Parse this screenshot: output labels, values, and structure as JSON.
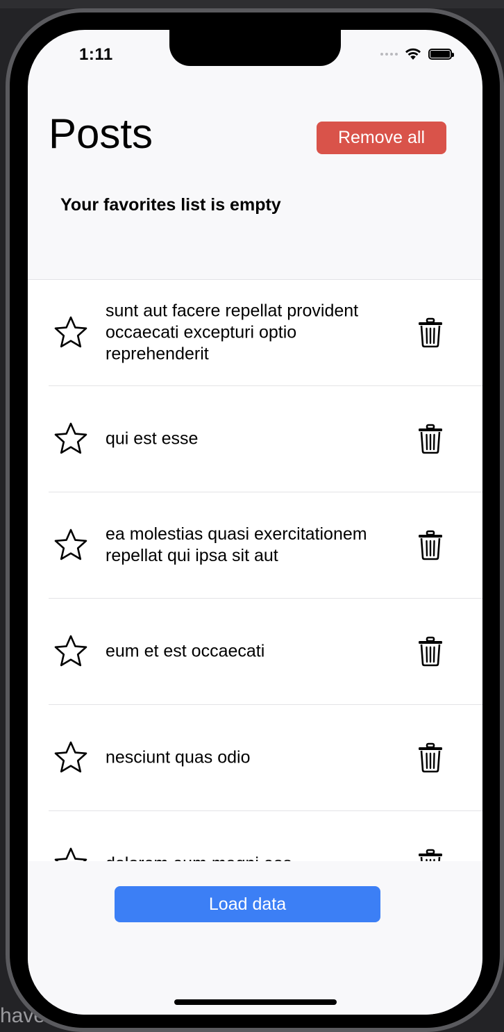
{
  "status_bar": {
    "time": "1:11"
  },
  "header": {
    "title": "Posts",
    "remove_all_label": "Remove all"
  },
  "favorites": {
    "empty_message": "Your favorites list is empty"
  },
  "posts": [
    {
      "title": "sunt aut facere repellat provident occaecati excepturi optio reprehenderit",
      "favorite": false
    },
    {
      "title": "qui est esse",
      "favorite": false
    },
    {
      "title": "ea molestias quasi exercitationem repellat qui ipsa sit aut",
      "favorite": false
    },
    {
      "title": "eum et est occaecati",
      "favorite": false
    },
    {
      "title": "nesciunt quas odio",
      "favorite": false
    },
    {
      "title": "dolorem eum magni eos",
      "favorite": false
    }
  ],
  "footer": {
    "load_data_label": "Load data"
  },
  "backdrop": {
    "partial_text": "have"
  },
  "colors": {
    "remove_all_bg": "#d9534a",
    "load_data_bg": "#3c7ff5",
    "screen_bg": "#f8f8fa"
  },
  "icons": {
    "favorite": "star-outline-icon",
    "delete": "trash-icon"
  }
}
